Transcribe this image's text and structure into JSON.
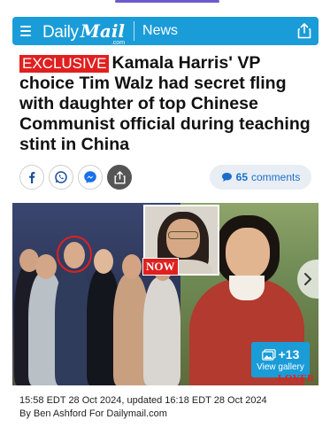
{
  "masthead": {
    "brand_daily": "Daily",
    "brand_mail": "Mail",
    "brand_dotcom": ".com",
    "section": "News",
    "menu_icon": "hamburger-icon",
    "share_icon": "share-icon",
    "color": "#1a9cd8"
  },
  "headline": {
    "badge": "EXCLUSIVE",
    "text": "Kamala Harris' VP choice Tim Walz had secret fling with daughter of top Chinese Communist official during teaching stint in China",
    "badge_color": "#e02020"
  },
  "social": {
    "buttons": [
      {
        "name": "facebook-icon"
      },
      {
        "name": "whatsapp-icon"
      },
      {
        "name": "messenger-icon"
      },
      {
        "name": "share-icon"
      }
    ]
  },
  "comments": {
    "count": "65",
    "label": "comments",
    "icon": "speech-bubble-icon"
  },
  "photo": {
    "now_badge": "NOW",
    "gallery_count": "+13",
    "gallery_label": "View gallery",
    "gallery_icon": "photos-icon",
    "next_icon": "chevron-right-icon",
    "cover_text": "LOVER THEN"
  },
  "byline": {
    "timestamp": "15:58 EDT 28 Oct 2024, updated 16:18 EDT 28 Oct 2024",
    "author": "By Ben Ashford For Dailymail.com"
  }
}
